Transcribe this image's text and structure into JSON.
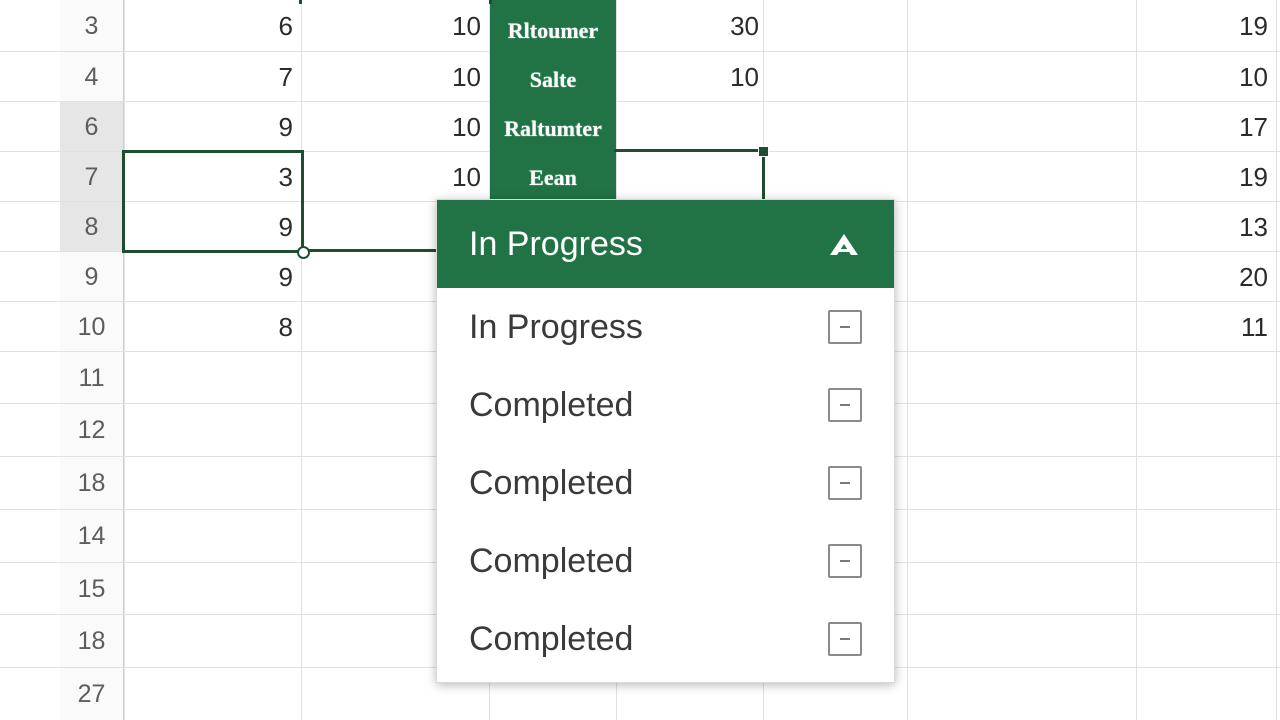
{
  "rows": [
    {
      "num": "3",
      "b": "6",
      "c": "10",
      "e": "30",
      "h": "19"
    },
    {
      "num": "4",
      "b": "7",
      "c": "10",
      "e": "10",
      "h": "10"
    },
    {
      "num": "6",
      "b": "9",
      "c": "10",
      "e": "",
      "h": "17"
    },
    {
      "num": "7",
      "b": "3",
      "c": "10",
      "e": "",
      "h": "19"
    },
    {
      "num": "8",
      "b": "9",
      "c": "",
      "e": "",
      "h": "13"
    },
    {
      "num": "9",
      "b": "9",
      "c": "",
      "e": "",
      "h": "20"
    },
    {
      "num": "10",
      "b": "8",
      "c": "",
      "e": "",
      "h": "11"
    },
    {
      "num": "11",
      "b": "",
      "c": "",
      "e": "",
      "h": ""
    },
    {
      "num": "12",
      "b": "",
      "c": "",
      "e": "",
      "h": ""
    },
    {
      "num": "18",
      "b": "",
      "c": "",
      "e": "",
      "h": ""
    },
    {
      "num": "14",
      "b": "",
      "c": "",
      "e": "",
      "h": ""
    },
    {
      "num": "15",
      "b": "",
      "c": "",
      "e": "",
      "h": ""
    },
    {
      "num": "18",
      "b": "",
      "c": "",
      "e": "",
      "h": ""
    },
    {
      "num": "27",
      "b": "",
      "c": "",
      "e": "",
      "h": ""
    }
  ],
  "green_column": [
    "Rltoumer",
    "Salte",
    "Raltumter",
    "Eean"
  ],
  "dropdown": {
    "selected": "In Progress",
    "caret_icon": "chevron-up-icon",
    "options": [
      "In Progress",
      "Completed",
      "Completed",
      "Completed",
      "Completed"
    ]
  },
  "colors": {
    "accent_green": "#217346",
    "selection_border": "#1e4d30"
  }
}
